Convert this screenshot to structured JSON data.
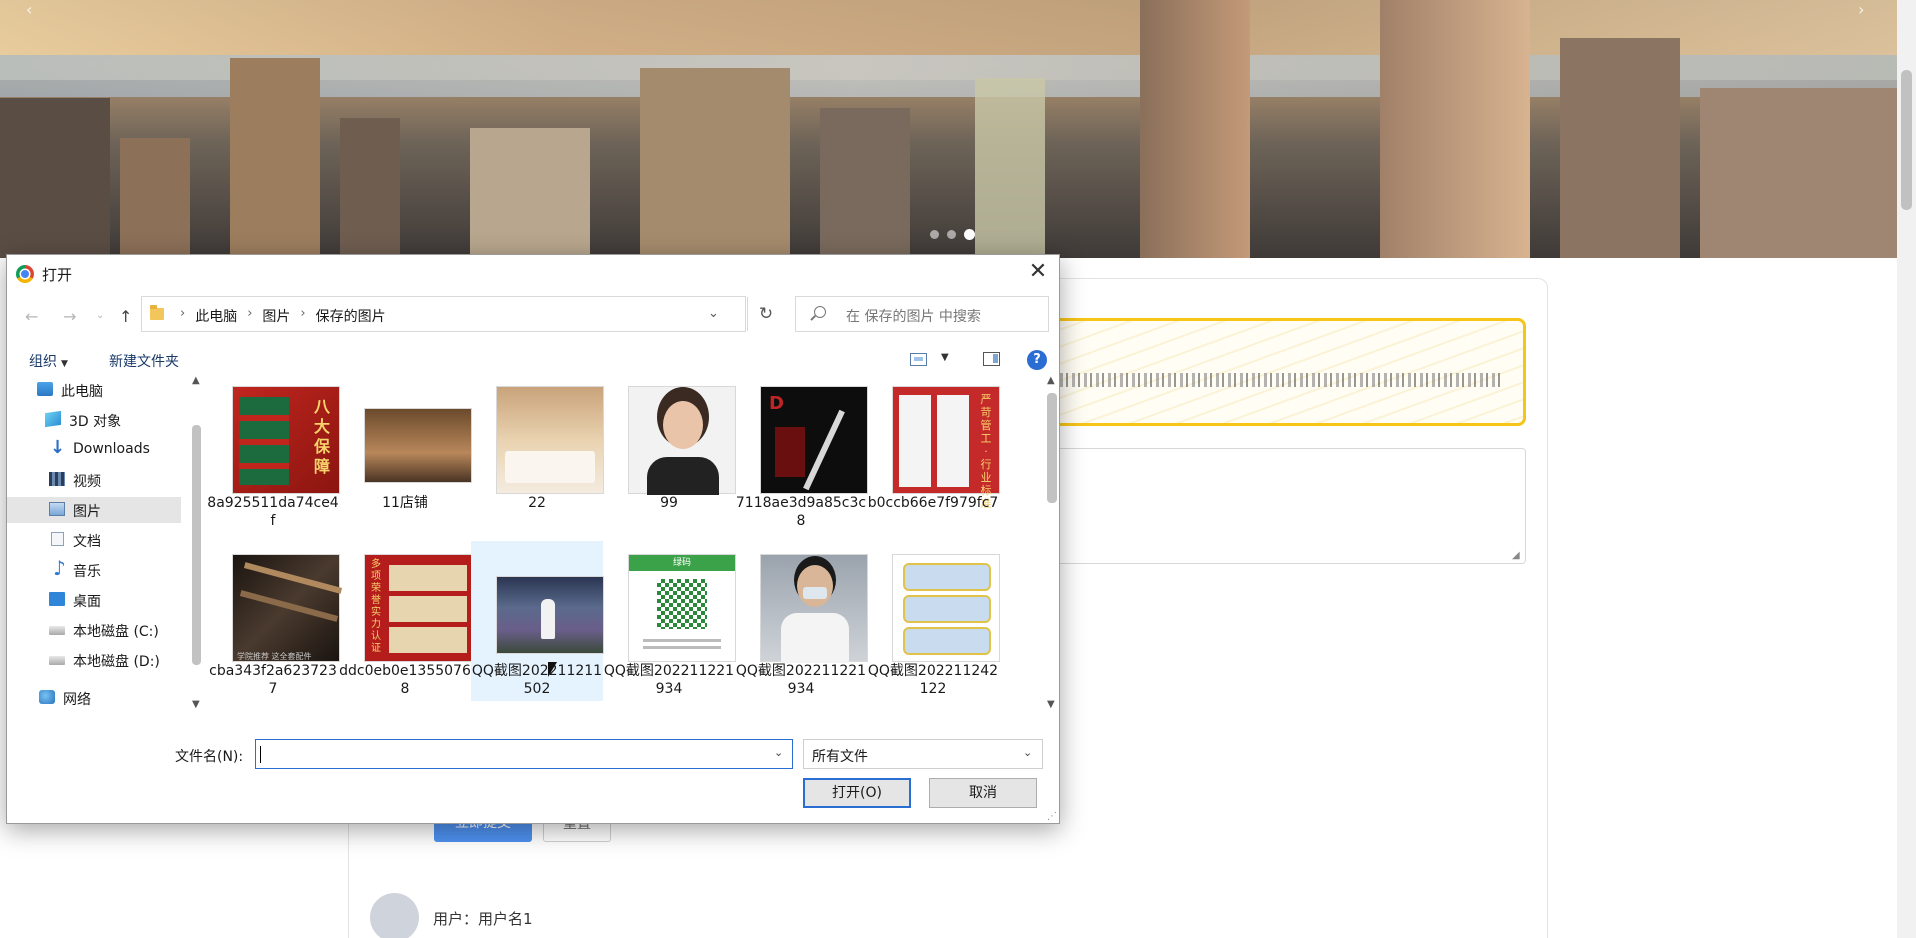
{
  "dialog": {
    "title": "打开",
    "close_label": "✕",
    "breadcrumb": [
      "此电脑",
      "图片",
      "保存的图片"
    ],
    "search_placeholder": "在 保存的图片 中搜索",
    "toolbar": {
      "organize": "组织",
      "new_folder": "新建文件夹"
    },
    "nav_items": [
      {
        "label": "此电脑",
        "icon": "computer-icon"
      },
      {
        "label": "3D 对象",
        "icon": "3d-objects-icon"
      },
      {
        "label": "Downloads",
        "icon": "download-icon"
      },
      {
        "label": "视频",
        "icon": "video-icon"
      },
      {
        "label": "图片",
        "icon": "pictures-icon",
        "selected": true
      },
      {
        "label": "文档",
        "icon": "document-icon"
      },
      {
        "label": "音乐",
        "icon": "music-icon"
      },
      {
        "label": "桌面",
        "icon": "desktop-icon"
      },
      {
        "label": "本地磁盘 (C:)",
        "icon": "drive-icon"
      },
      {
        "label": "本地磁盘 (D:)",
        "icon": "drive-icon"
      },
      {
        "label": "网络",
        "icon": "network-icon"
      }
    ],
    "files": [
      {
        "name": "8a925511da74ce4f"
      },
      {
        "name": "11店铺"
      },
      {
        "name": "22"
      },
      {
        "name": "99"
      },
      {
        "name": "7118ae3d9a85c3c8"
      },
      {
        "name": "b0ccb66e7f979fc7"
      },
      {
        "name": "cba343f2a6237237"
      },
      {
        "name": "ddc0eb0e13550768"
      },
      {
        "name": "QQ截图202211211502"
      },
      {
        "name": "QQ截图202211221934"
      },
      {
        "name": "QQ截图202211221934"
      },
      {
        "name": "QQ截图202211242122"
      }
    ],
    "thumb_texts": {
      "f1": "八大保障",
      "f5": "D",
      "f6": "严苛管工 · 行业标准",
      "f7": "学院推荐 这全套配件",
      "f8": "多项荣誉 实力认证",
      "f10": "绿码"
    },
    "filename_label": "文件名(N):",
    "filename_value": "",
    "file_type": "所有文件",
    "open_button": "打开(O)",
    "cancel_button": "取消",
    "accent_color": "#2b6ed3"
  },
  "background_page": {
    "submit_label": "立即提交",
    "reset_label": "重置",
    "user_label": "用户：用户名1"
  }
}
